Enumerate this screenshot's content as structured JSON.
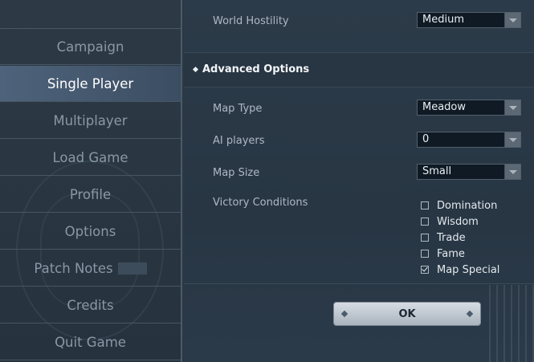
{
  "sidebar": {
    "items": [
      {
        "label": "Campaign"
      },
      {
        "label": "Single Player"
      },
      {
        "label": "Multiplayer"
      },
      {
        "label": "Load Game"
      },
      {
        "label": "Profile"
      },
      {
        "label": "Options"
      },
      {
        "label": "Patch Notes"
      },
      {
        "label": "Credits"
      },
      {
        "label": "Quit Game"
      }
    ],
    "active_index": 1
  },
  "settings": {
    "world_hostility": {
      "label": "World Hostility",
      "value": "Medium"
    },
    "advanced_title": "Advanced Options",
    "map_type": {
      "label": "Map Type",
      "value": "Meadow"
    },
    "ai_players": {
      "label": "AI players",
      "value": "0"
    },
    "map_size": {
      "label": "Map Size",
      "value": "Small"
    },
    "victory": {
      "label": "Victory Conditions",
      "options": [
        {
          "label": "Domination",
          "checked": false
        },
        {
          "label": "Wisdom",
          "checked": false
        },
        {
          "label": "Trade",
          "checked": false
        },
        {
          "label": "Fame",
          "checked": false
        },
        {
          "label": "Map Special",
          "checked": true
        }
      ]
    }
  },
  "ok_label": "OK",
  "icons": {
    "dropdown_arrow": "chevron-down-icon",
    "section_marker": "diamond-icon",
    "checkbox": "checkbox-icon"
  },
  "colors": {
    "active_item": "#4e637b",
    "panel_bg": "#2a3845",
    "dropdown_bg": "#101a24"
  }
}
